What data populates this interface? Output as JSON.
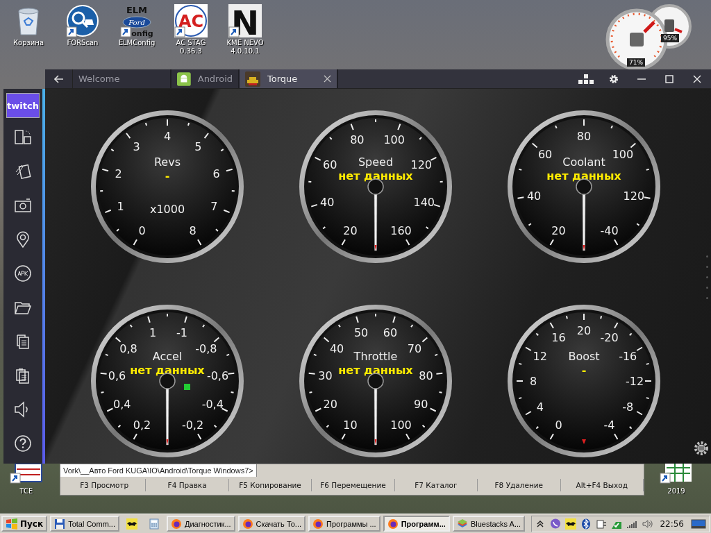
{
  "desktop_icons": [
    {
      "kind": "recycle-bin",
      "label": "Корзина"
    },
    {
      "kind": "forscan",
      "label": "FORScan"
    },
    {
      "kind": "elmconfig",
      "label": "ELMConfig",
      "logo": [
        "ELM",
        "Ford",
        "onfig"
      ]
    },
    {
      "kind": "acstag",
      "label": "AC STAG 0.36.3",
      "logo": [
        "AC"
      ]
    },
    {
      "kind": "kme",
      "label": "KME NEVO 4.0.10.1",
      "logo": [
        "N"
      ]
    }
  ],
  "bottom_icons": [
    {
      "kind": "tce",
      "label": "TCE"
    },
    {
      "kind": "sheet",
      "label": "2019"
    }
  ],
  "gadget": {
    "cpu": {
      "reading": "71%"
    },
    "memory": {
      "reading": "95%"
    }
  },
  "window": {
    "tabs": [
      {
        "label": "Welcome",
        "kind": "plain",
        "selected": false
      },
      {
        "label": "Android",
        "kind": "android",
        "selected": false
      },
      {
        "label": "Torque",
        "kind": "torque",
        "selected": true
      }
    ]
  },
  "sidebar": {
    "logo": "twitch"
  },
  "gauges": [
    {
      "title": "Revs",
      "unit": "x1000",
      "reading": "-",
      "kind": "none",
      "indicator": false,
      "labels": [
        "0",
        "1",
        "2",
        "3",
        "4",
        "5",
        "6",
        "7",
        "8"
      ]
    },
    {
      "title": "Speed",
      "reading": "нет данных",
      "kind": "needle",
      "indicator": false,
      "labels": [
        "20",
        "40",
        "60",
        "80",
        "100",
        "120",
        "140",
        "160"
      ]
    },
    {
      "title": "Coolant",
      "reading": "нет данных",
      "kind": "needle",
      "indicator": false,
      "labels": [
        "20",
        "40",
        "60",
        "80",
        "100",
        "120",
        "-40"
      ]
    },
    {
      "title": "Accel",
      "reading": "нет данных",
      "kind": "needle",
      "indicator": true,
      "labels": [
        "0,2",
        "0,4",
        "0,6",
        "0,8",
        "1",
        "-1",
        "-0,8",
        "-0,6",
        "-0,4",
        "-0,2"
      ]
    },
    {
      "title": "Throttle",
      "reading": "нет данных",
      "kind": "needle",
      "indicator": false,
      "labels": [
        "10",
        "20",
        "30",
        "40",
        "50",
        "60",
        "70",
        "80",
        "90",
        "100"
      ]
    },
    {
      "title": "Boost",
      "reading": "-",
      "kind": "dot",
      "indicator": false,
      "labels": [
        "0",
        "4",
        "8",
        "12",
        "16",
        "20",
        "-20",
        "-16",
        "-12",
        "-8",
        "-4"
      ]
    }
  ],
  "commander": {
    "path": "Vork\\__Авто Ford KUGA\\IO\\Android\\Torque Windows7>",
    "keys": [
      "F3 Просмотр",
      "F4 Правка",
      "F5 Копирование",
      "F6 Перемещение",
      "F7 Каталог",
      "F8 Удаление",
      "Alt+F4 Выход"
    ]
  },
  "taskbar": {
    "start": "Пуск",
    "items": [
      {
        "kind": "floppy",
        "label": "Total Comm...",
        "selected": false
      },
      {
        "kind": "bat"
      },
      {
        "kind": "calculator"
      },
      {
        "kind": "firefox",
        "label": "Диагностик...",
        "selected": false
      },
      {
        "kind": "firefox",
        "label": "Скачать То...",
        "selected": false
      },
      {
        "kind": "firefox",
        "label": "Программы ...",
        "selected": false
      },
      {
        "kind": "firefox",
        "label": "Программ...",
        "selected": true
      },
      {
        "kind": "bluestacks",
        "label": "Bluestacks A...",
        "selected": false
      }
    ],
    "clock": "22:56"
  }
}
